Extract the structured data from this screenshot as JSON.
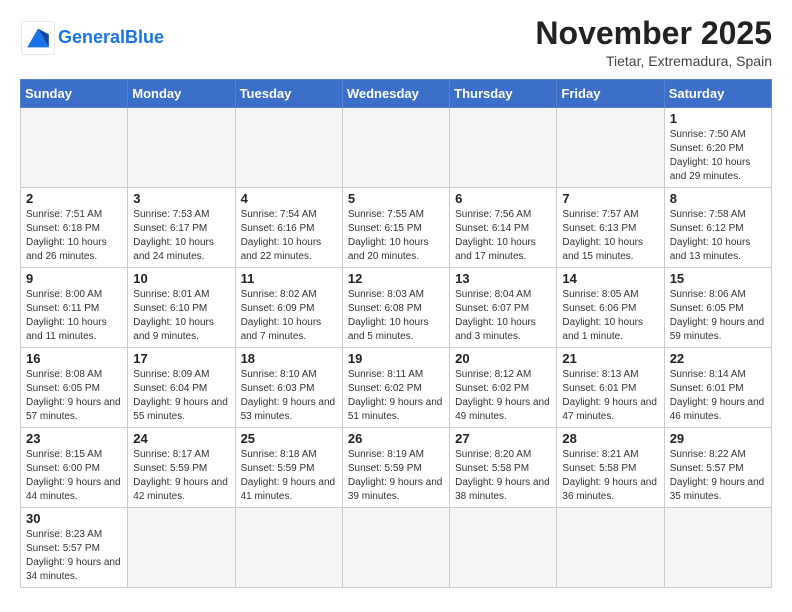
{
  "header": {
    "logo_general": "General",
    "logo_blue": "Blue",
    "month": "November 2025",
    "location": "Tietar, Extremadura, Spain"
  },
  "weekdays": [
    "Sunday",
    "Monday",
    "Tuesday",
    "Wednesday",
    "Thursday",
    "Friday",
    "Saturday"
  ],
  "weeks": [
    [
      {
        "day": "",
        "info": ""
      },
      {
        "day": "",
        "info": ""
      },
      {
        "day": "",
        "info": ""
      },
      {
        "day": "",
        "info": ""
      },
      {
        "day": "",
        "info": ""
      },
      {
        "day": "",
        "info": ""
      },
      {
        "day": "1",
        "info": "Sunrise: 7:50 AM\nSunset: 6:20 PM\nDaylight: 10 hours and 29 minutes."
      }
    ],
    [
      {
        "day": "2",
        "info": "Sunrise: 7:51 AM\nSunset: 6:18 PM\nDaylight: 10 hours and 26 minutes."
      },
      {
        "day": "3",
        "info": "Sunrise: 7:53 AM\nSunset: 6:17 PM\nDaylight: 10 hours and 24 minutes."
      },
      {
        "day": "4",
        "info": "Sunrise: 7:54 AM\nSunset: 6:16 PM\nDaylight: 10 hours and 22 minutes."
      },
      {
        "day": "5",
        "info": "Sunrise: 7:55 AM\nSunset: 6:15 PM\nDaylight: 10 hours and 20 minutes."
      },
      {
        "day": "6",
        "info": "Sunrise: 7:56 AM\nSunset: 6:14 PM\nDaylight: 10 hours and 17 minutes."
      },
      {
        "day": "7",
        "info": "Sunrise: 7:57 AM\nSunset: 6:13 PM\nDaylight: 10 hours and 15 minutes."
      },
      {
        "day": "8",
        "info": "Sunrise: 7:58 AM\nSunset: 6:12 PM\nDaylight: 10 hours and 13 minutes."
      }
    ],
    [
      {
        "day": "9",
        "info": "Sunrise: 8:00 AM\nSunset: 6:11 PM\nDaylight: 10 hours and 11 minutes."
      },
      {
        "day": "10",
        "info": "Sunrise: 8:01 AM\nSunset: 6:10 PM\nDaylight: 10 hours and 9 minutes."
      },
      {
        "day": "11",
        "info": "Sunrise: 8:02 AM\nSunset: 6:09 PM\nDaylight: 10 hours and 7 minutes."
      },
      {
        "day": "12",
        "info": "Sunrise: 8:03 AM\nSunset: 6:08 PM\nDaylight: 10 hours and 5 minutes."
      },
      {
        "day": "13",
        "info": "Sunrise: 8:04 AM\nSunset: 6:07 PM\nDaylight: 10 hours and 3 minutes."
      },
      {
        "day": "14",
        "info": "Sunrise: 8:05 AM\nSunset: 6:06 PM\nDaylight: 10 hours and 1 minute."
      },
      {
        "day": "15",
        "info": "Sunrise: 8:06 AM\nSunset: 6:05 PM\nDaylight: 9 hours and 59 minutes."
      }
    ],
    [
      {
        "day": "16",
        "info": "Sunrise: 8:08 AM\nSunset: 6:05 PM\nDaylight: 9 hours and 57 minutes."
      },
      {
        "day": "17",
        "info": "Sunrise: 8:09 AM\nSunset: 6:04 PM\nDaylight: 9 hours and 55 minutes."
      },
      {
        "day": "18",
        "info": "Sunrise: 8:10 AM\nSunset: 6:03 PM\nDaylight: 9 hours and 53 minutes."
      },
      {
        "day": "19",
        "info": "Sunrise: 8:11 AM\nSunset: 6:02 PM\nDaylight: 9 hours and 51 minutes."
      },
      {
        "day": "20",
        "info": "Sunrise: 8:12 AM\nSunset: 6:02 PM\nDaylight: 9 hours and 49 minutes."
      },
      {
        "day": "21",
        "info": "Sunrise: 8:13 AM\nSunset: 6:01 PM\nDaylight: 9 hours and 47 minutes."
      },
      {
        "day": "22",
        "info": "Sunrise: 8:14 AM\nSunset: 6:01 PM\nDaylight: 9 hours and 46 minutes."
      }
    ],
    [
      {
        "day": "23",
        "info": "Sunrise: 8:15 AM\nSunset: 6:00 PM\nDaylight: 9 hours and 44 minutes."
      },
      {
        "day": "24",
        "info": "Sunrise: 8:17 AM\nSunset: 5:59 PM\nDaylight: 9 hours and 42 minutes."
      },
      {
        "day": "25",
        "info": "Sunrise: 8:18 AM\nSunset: 5:59 PM\nDaylight: 9 hours and 41 minutes."
      },
      {
        "day": "26",
        "info": "Sunrise: 8:19 AM\nSunset: 5:59 PM\nDaylight: 9 hours and 39 minutes."
      },
      {
        "day": "27",
        "info": "Sunrise: 8:20 AM\nSunset: 5:58 PM\nDaylight: 9 hours and 38 minutes."
      },
      {
        "day": "28",
        "info": "Sunrise: 8:21 AM\nSunset: 5:58 PM\nDaylight: 9 hours and 36 minutes."
      },
      {
        "day": "29",
        "info": "Sunrise: 8:22 AM\nSunset: 5:57 PM\nDaylight: 9 hours and 35 minutes."
      }
    ],
    [
      {
        "day": "30",
        "info": "Sunrise: 8:23 AM\nSunset: 5:57 PM\nDaylight: 9 hours and 34 minutes."
      },
      {
        "day": "",
        "info": ""
      },
      {
        "day": "",
        "info": ""
      },
      {
        "day": "",
        "info": ""
      },
      {
        "day": "",
        "info": ""
      },
      {
        "day": "",
        "info": ""
      },
      {
        "day": "",
        "info": ""
      }
    ]
  ]
}
